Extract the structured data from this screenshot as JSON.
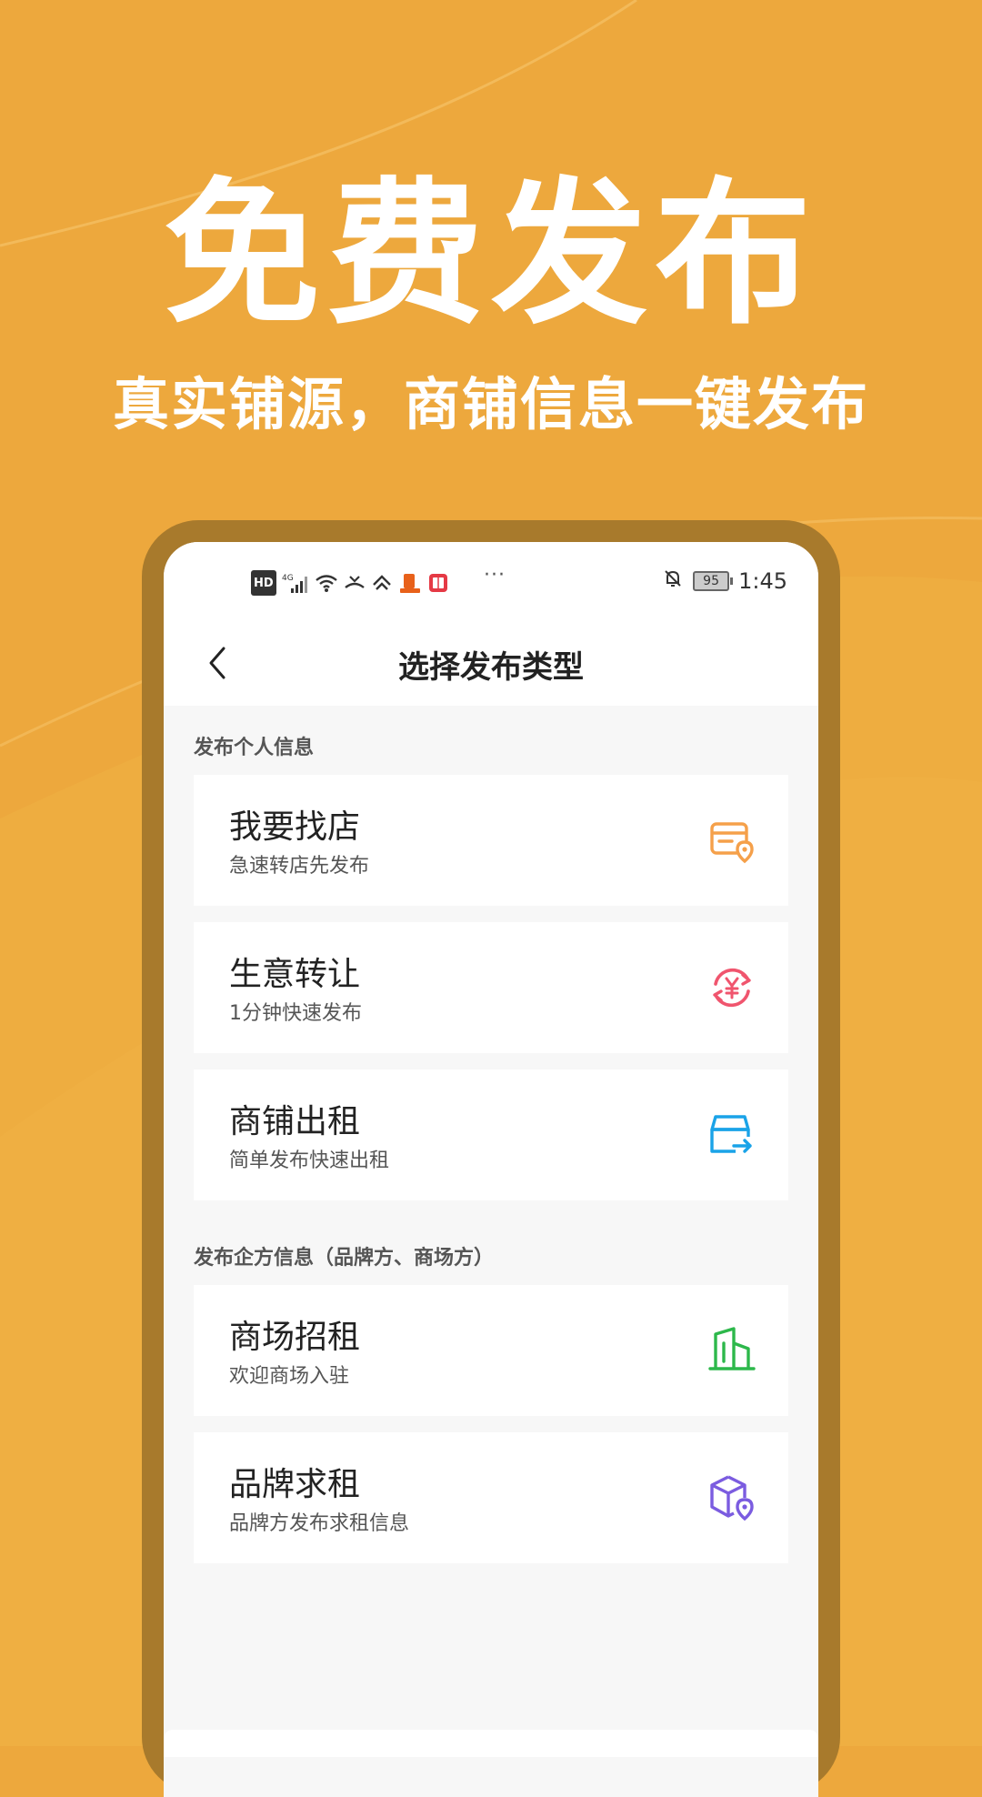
{
  "hero": {
    "headline": "免费发布",
    "subline": "真实铺源，商铺信息一键发布"
  },
  "status_bar": {
    "hd": "HD",
    "network": "4G",
    "dots": "···",
    "battery": "95",
    "time": "1:45"
  },
  "nav": {
    "title": "选择发布类型"
  },
  "sections": [
    {
      "label": "发布个人信息",
      "items": [
        {
          "title": "我要找店",
          "subtitle": "急速转店先发布",
          "icon": "shop-location-icon",
          "color": "#F5A04A"
        },
        {
          "title": "生意转让",
          "subtitle": "1分钟快速发布",
          "icon": "yuan-transfer-icon",
          "color": "#F0556E"
        },
        {
          "title": "商铺出租",
          "subtitle": "简单发布快速出租",
          "icon": "shop-rent-icon",
          "color": "#1AA3E8"
        }
      ]
    },
    {
      "label": "发布企方信息（品牌方、商场方）",
      "items": [
        {
          "title": "商场招租",
          "subtitle": "欢迎商场入驻",
          "icon": "building-icon",
          "color": "#2DB84B"
        },
        {
          "title": "品牌求租",
          "subtitle": "品牌方发布求租信息",
          "icon": "box-location-icon",
          "color": "#7B5CE0"
        }
      ]
    }
  ],
  "colors": {
    "background": "#EDA83D",
    "phone_frame": "#A87A2C",
    "screen_bg": "#F7F7F7"
  }
}
